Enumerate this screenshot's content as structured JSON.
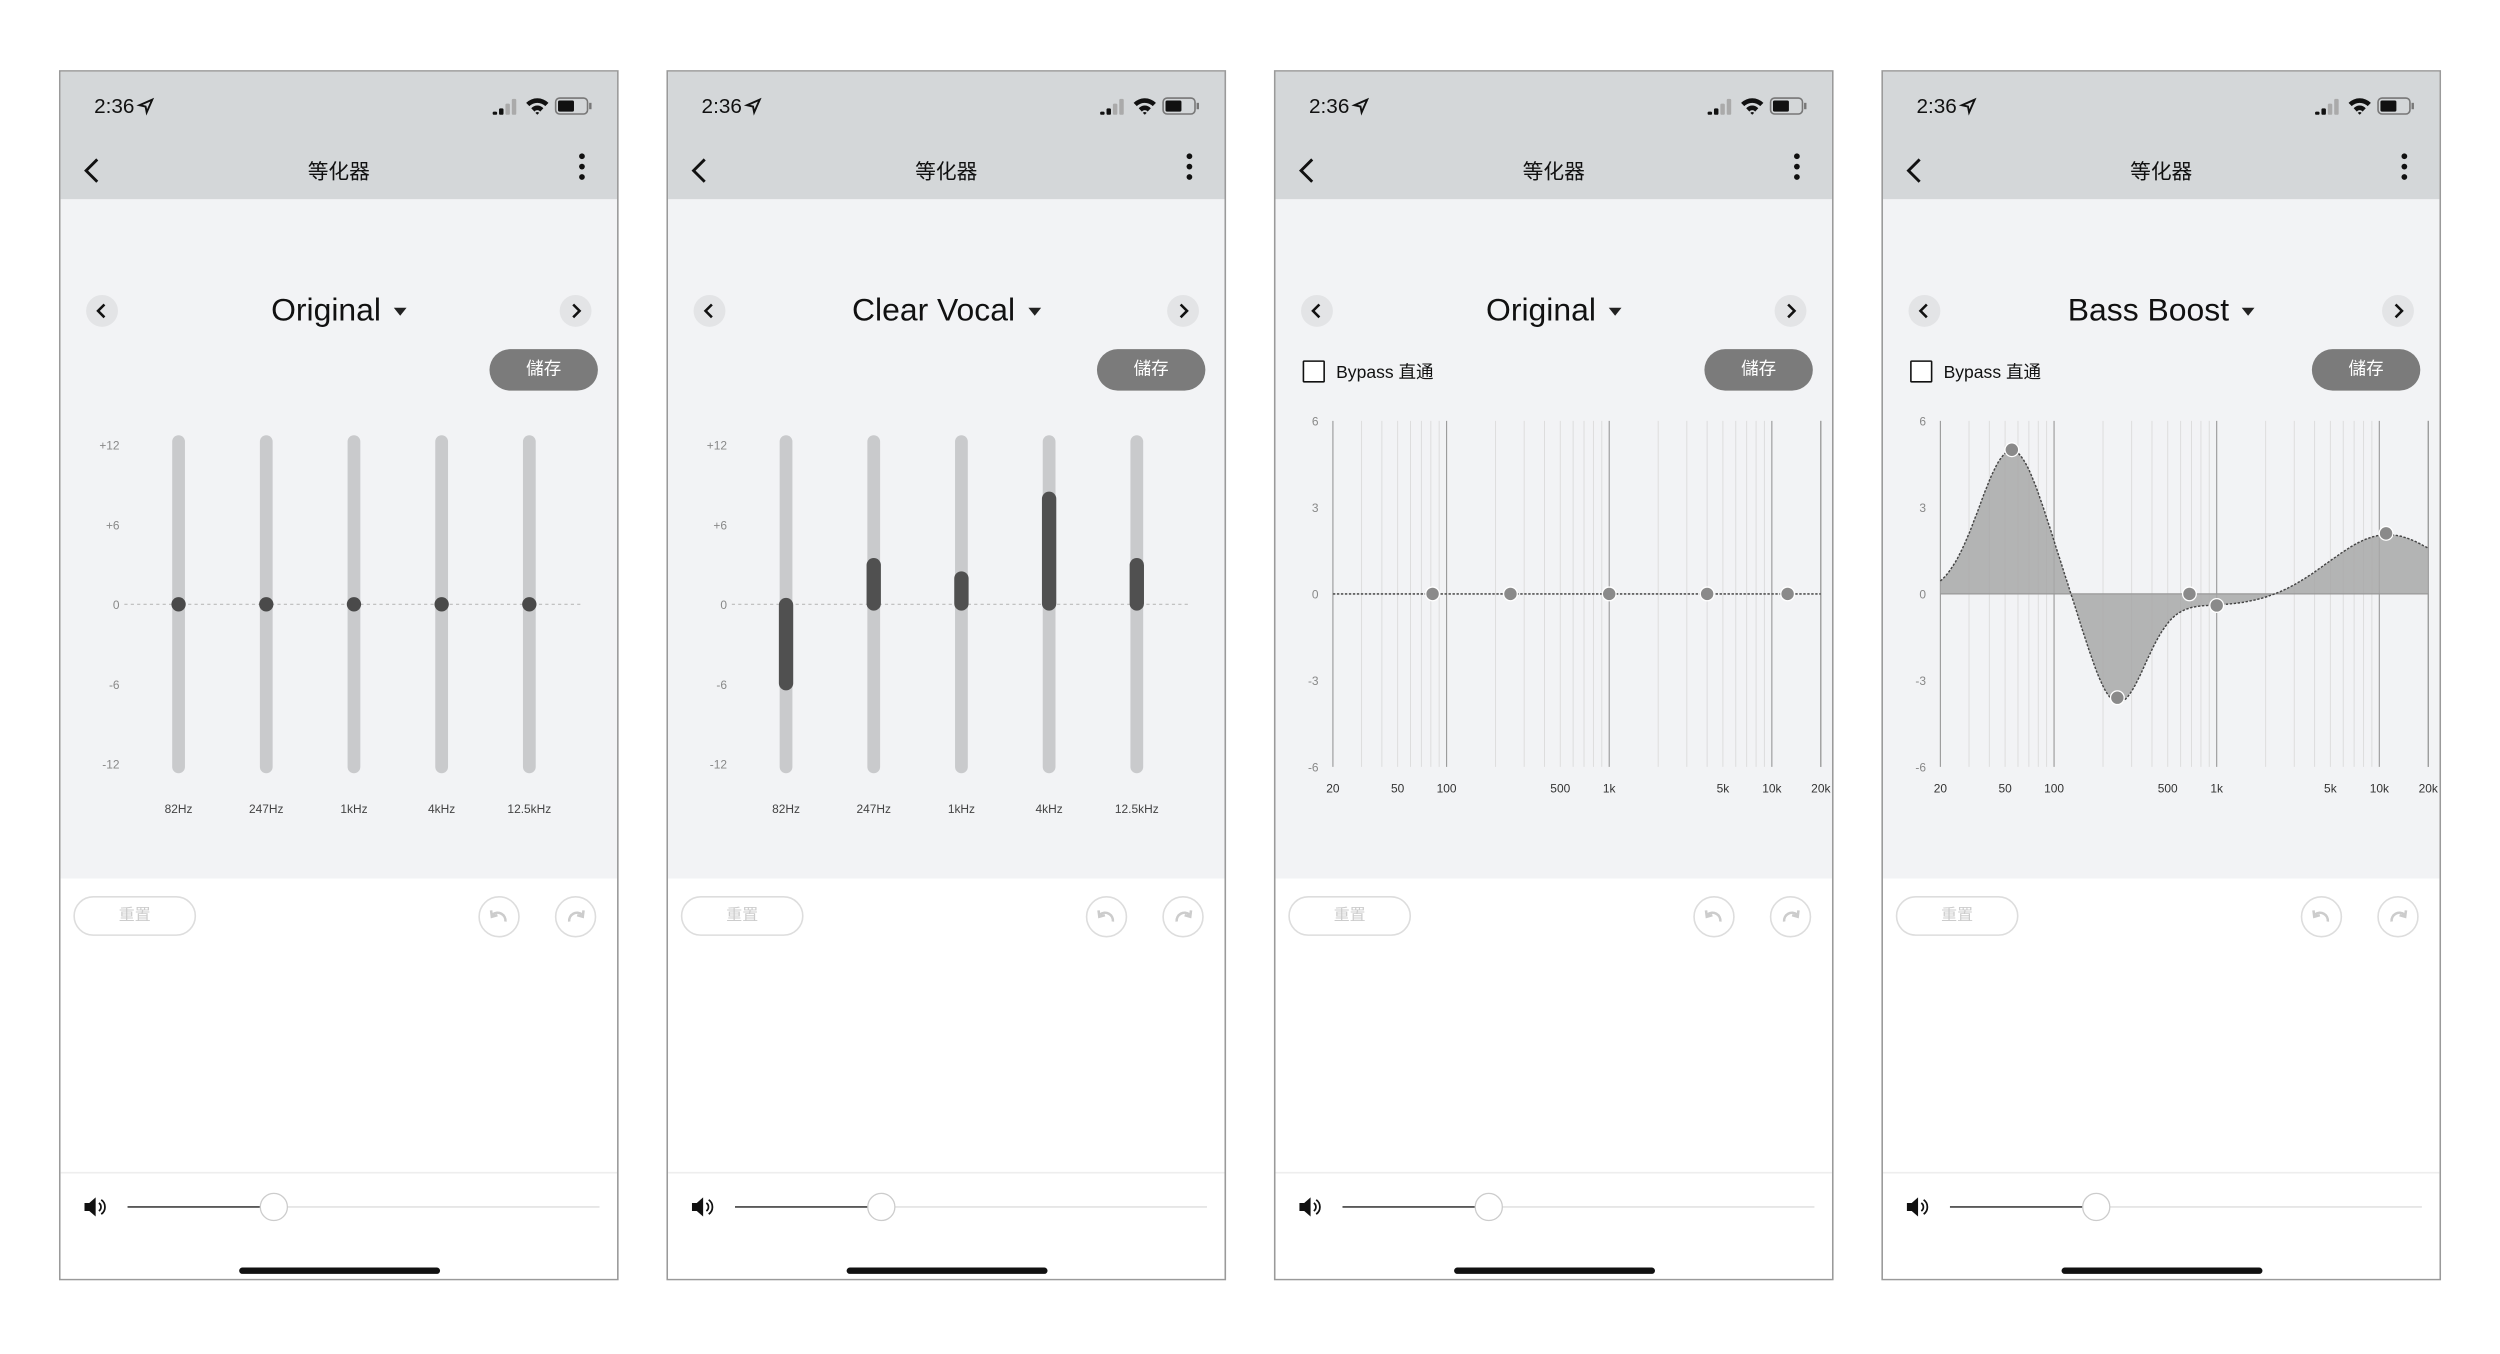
{
  "status_bar": {
    "time": "2:36"
  },
  "nav": {
    "title": "等化器"
  },
  "labels": {
    "save": "儲存",
    "reset": "重置",
    "bypass": "Bypass 直通"
  },
  "colors": {
    "topbar": "#d4d7d9",
    "panel": "#f2f3f5",
    "save_button": "#7b7b7b",
    "slider_fill": "#505050",
    "track": "#c9cacc",
    "curve_fill": "#a8a8a8"
  },
  "icons": {
    "back": "chevron-left-icon",
    "menu": "kebab-menu-icon",
    "prev": "chevron-left-icon",
    "next": "chevron-right-icon",
    "dropdown": "caret-down-icon",
    "undo": "undo-icon",
    "redo": "redo-icon",
    "volume": "speaker-icon",
    "signal": "signal-icon",
    "wifi": "wifi-icon",
    "battery": "battery-icon",
    "location": "location-arrow-icon"
  },
  "phones": [
    {
      "preset": "Original",
      "mode": "sliders",
      "show_bypass": false,
      "bypass_checked": false,
      "volume": 0.31
    },
    {
      "preset": "Clear Vocal",
      "mode": "sliders",
      "show_bypass": false,
      "bypass_checked": false,
      "volume": 0.31
    },
    {
      "preset": "Original",
      "mode": "graph",
      "show_bypass": true,
      "bypass_checked": false,
      "volume": 0.31
    },
    {
      "preset": "Bass Boost",
      "mode": "graph",
      "show_bypass": true,
      "bypass_checked": false,
      "volume": 0.31
    }
  ],
  "chart_data": [
    {
      "type": "bar",
      "chart": "slider-eq",
      "categories": [
        "82Hz",
        "247Hz",
        "1kHz",
        "4kHz",
        "12.5kHz"
      ],
      "values": [
        0,
        0,
        0,
        0,
        0
      ],
      "yticks": [
        "+12",
        "+6",
        "0",
        "-6",
        "-12"
      ],
      "ylim": [
        -12,
        12
      ]
    },
    {
      "type": "bar",
      "chart": "slider-eq",
      "categories": [
        "82Hz",
        "247Hz",
        "1kHz",
        "4kHz",
        "12.5kHz"
      ],
      "values": [
        -6,
        3,
        2,
        8,
        3
      ],
      "yticks": [
        "+12",
        "+6",
        "0",
        "-6",
        "-12"
      ],
      "ylim": [
        -12,
        12
      ]
    },
    {
      "type": "line",
      "chart": "parametric-eq",
      "x_scale": "log",
      "xlim": [
        20,
        20000
      ],
      "ylim": [
        -6,
        6
      ],
      "grid": true,
      "xticks": [
        "20",
        "50",
        "100",
        "500",
        "1k",
        "5k",
        "10k",
        "20k"
      ],
      "yticks": [
        "6",
        "3",
        "0",
        "-3",
        "-6"
      ],
      "bands": [
        {
          "freq": 82,
          "gain": 0
        },
        {
          "freq": 247,
          "gain": 0
        },
        {
          "freq": 1000,
          "gain": 0
        },
        {
          "freq": 4000,
          "gain": 0
        },
        {
          "freq": 12500,
          "gain": 0
        }
      ]
    },
    {
      "type": "area",
      "chart": "parametric-eq",
      "x_scale": "log",
      "xlim": [
        20,
        20000
      ],
      "ylim": [
        -6,
        6
      ],
      "grid": true,
      "xticks": [
        "20",
        "50",
        "100",
        "500",
        "1k",
        "5k",
        "10k",
        "20k"
      ],
      "yticks": [
        "6",
        "3",
        "0",
        "-3",
        "-6"
      ],
      "bands": [
        {
          "freq": 55,
          "gain": 5.0
        },
        {
          "freq": 245,
          "gain": -3.6
        },
        {
          "freq": 680,
          "gain": 0
        },
        {
          "freq": 1000,
          "gain": -0.4
        },
        {
          "freq": 11000,
          "gain": 2.1
        }
      ]
    }
  ]
}
